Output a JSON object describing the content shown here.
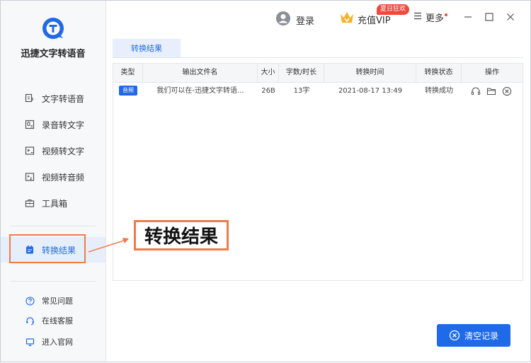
{
  "app": {
    "name": "迅捷文字转语音"
  },
  "sidebar": {
    "items": [
      {
        "label": "文字转语音"
      },
      {
        "label": "录音转文字"
      },
      {
        "label": "视频转文字"
      },
      {
        "label": "视频转音频"
      },
      {
        "label": "工具箱"
      },
      {
        "label": "转换结果"
      }
    ],
    "bottom": [
      {
        "label": "常见问题"
      },
      {
        "label": "在线客服"
      },
      {
        "label": "进入官网"
      }
    ]
  },
  "header": {
    "login": "登录",
    "vip": "充值VIP",
    "vip_badge": "夏日狂欢",
    "more": "更多"
  },
  "tab": {
    "label": "转换结果"
  },
  "table": {
    "headers": [
      "类型",
      "输出文件名",
      "大小",
      "字数/时长",
      "转换时间",
      "转换状态",
      "操作"
    ],
    "rows": [
      {
        "type": "音频",
        "filename": "我们可以在-迅捷文字转语...",
        "size": "26B",
        "count": "13字",
        "time": "2021-08-17 13:49",
        "status": "转换成功"
      }
    ]
  },
  "annotation": {
    "text": "转换结果"
  },
  "footer": {
    "clear": "清空记录"
  },
  "colors": {
    "accent": "#1f6ae8",
    "highlight": "#f07a48",
    "badge": "#f0483d"
  }
}
